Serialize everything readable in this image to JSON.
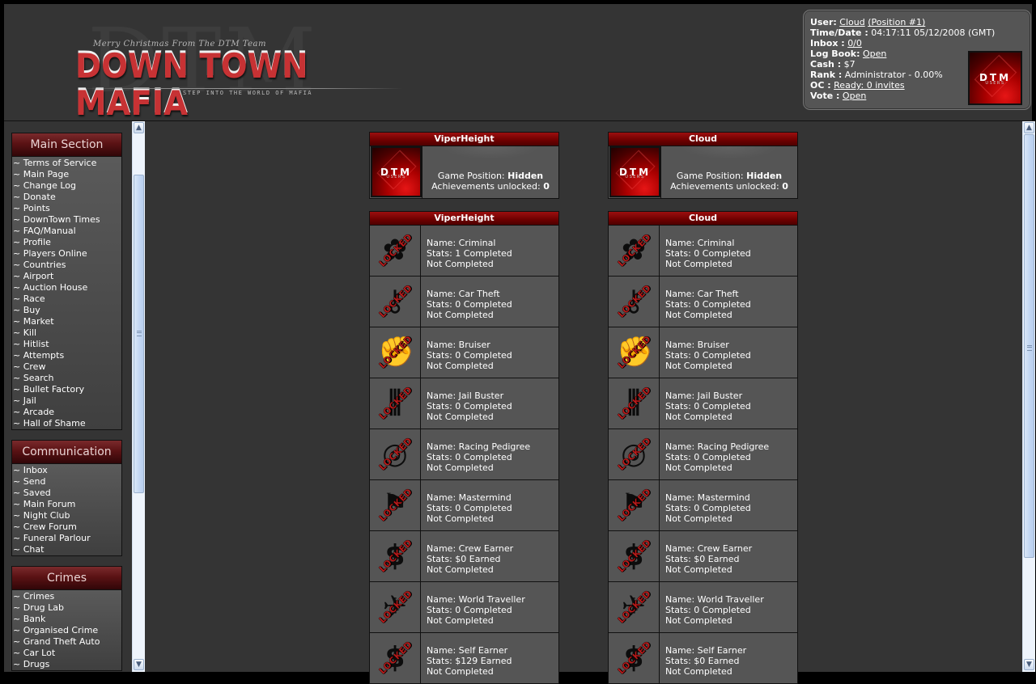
{
  "header": {
    "logo": {
      "watermark": "DTM",
      "greeting": "Merry Christmas From The DTM Team",
      "title": "DOWN TOWN MAFIA",
      "tagline": "STEP INTO THE WORLD OF MAFIA"
    },
    "userbox": {
      "user_label": "User:",
      "user_name": "Cloud",
      "user_position": "(Position #1)",
      "time_label": "Time/Date :",
      "time_value": "04:17:11 05/12/2008 (GMT)",
      "inbox_label": "Inbox :",
      "inbox_value": "0/0",
      "logbook_label": "Log Book:",
      "logbook_value": "Open",
      "cash_label": "Cash :",
      "cash_value": "$7",
      "rank_label": "Rank :",
      "rank_value": "Administrator - 0.00%",
      "oc_label": "OC :",
      "oc_value": "Ready: 0 invites",
      "vote_label": "Vote :",
      "vote_value": "Open",
      "avatar": {
        "title": "DTM",
        "subtitle": "USERS"
      }
    }
  },
  "sidebar": {
    "panels": [
      {
        "title": "Main Section",
        "items": [
          "Terms of Service",
          "Main Page",
          "Change Log",
          "Donate",
          "Points",
          "DownTown Times",
          "FAQ/Manual",
          "Profile",
          "Players Online",
          "Countries",
          "Airport",
          "Auction House",
          "Race",
          "Buy",
          "Market",
          "Kill",
          "Hitlist",
          "Attempts",
          "Crew",
          "Search",
          "Bullet Factory",
          "Jail",
          "Arcade",
          "Hall of Shame"
        ]
      },
      {
        "title": "Communication",
        "items": [
          "Inbox",
          "Send",
          "Saved",
          "Main Forum",
          "Night Club",
          "Crew Forum",
          "Funeral Parlour",
          "Chat"
        ]
      },
      {
        "title": "Crimes",
        "items": [
          "Crimes",
          "Drug Lab",
          "Bank",
          "Organised Crime",
          "Grand Theft Auto",
          "Car Lot",
          "Drugs"
        ]
      }
    ]
  },
  "main": {
    "locked_stamp": "LOCKED",
    "position_label": "Game Position:",
    "achievements_label": "Achievements unlocked:",
    "columns": [
      {
        "player": "ViperHeight",
        "game_position": "Hidden",
        "achievements_unlocked": "0",
        "avatar": {
          "title": "DTM",
          "subtitle": "USERS"
        },
        "achievements": [
          {
            "icon": "criminal-icon",
            "name": "Name: Criminal",
            "stats": "Stats: 1 Completed",
            "status": "Not Completed"
          },
          {
            "icon": "car-keys-icon",
            "name": "Name: Car Theft",
            "stats": "Stats: 0 Completed",
            "status": "Not Completed"
          },
          {
            "icon": "fist-icon",
            "name": "Name: Bruiser",
            "stats": "Stats: 0 Completed",
            "status": "Not Completed"
          },
          {
            "icon": "jail-icon",
            "name": "Name: Jail Buster",
            "stats": "Stats: 0 Completed",
            "status": "Not Completed"
          },
          {
            "icon": "steering-wheel-icon",
            "name": "Name: Racing Pedigree",
            "stats": "Stats: 0 Completed",
            "status": "Not Completed"
          },
          {
            "icon": "gunman-icon",
            "name": "Name: Mastermind",
            "stats": "Stats: 0 Completed",
            "status": "Not Completed"
          },
          {
            "icon": "crew-dollar-icon",
            "name": "Name: Crew Earner",
            "stats": "Stats: $0 Earned",
            "status": "Not Completed"
          },
          {
            "icon": "airplane-icon",
            "name": "Name: World Traveller",
            "stats": "Stats: 0 Completed",
            "status": "Not Completed"
          },
          {
            "icon": "dollar-icon",
            "name": "Name: Self Earner",
            "stats": "Stats: $129 Earned",
            "status": "Not Completed"
          }
        ]
      },
      {
        "player": "Cloud",
        "game_position": "Hidden",
        "achievements_unlocked": "0",
        "avatar": {
          "title": "DTM",
          "subtitle": "USERS"
        },
        "achievements": [
          {
            "icon": "criminal-icon",
            "name": "Name: Criminal",
            "stats": "Stats: 0 Completed",
            "status": "Not Completed"
          },
          {
            "icon": "car-keys-icon",
            "name": "Name: Car Theft",
            "stats": "Stats: 0 Completed",
            "status": "Not Completed"
          },
          {
            "icon": "fist-icon",
            "name": "Name: Bruiser",
            "stats": "Stats: 0 Completed",
            "status": "Not Completed"
          },
          {
            "icon": "jail-icon",
            "name": "Name: Jail Buster",
            "stats": "Stats: 0 Completed",
            "status": "Not Completed"
          },
          {
            "icon": "steering-wheel-icon",
            "name": "Name: Racing Pedigree",
            "stats": "Stats: 0 Completed",
            "status": "Not Completed"
          },
          {
            "icon": "gunman-icon",
            "name": "Name: Mastermind",
            "stats": "Stats: 0 Completed",
            "status": "Not Completed"
          },
          {
            "icon": "crew-dollar-icon",
            "name": "Name: Crew Earner",
            "stats": "Stats: $0 Earned",
            "status": "Not Completed"
          },
          {
            "icon": "airplane-icon",
            "name": "Name: World Traveller",
            "stats": "Stats: 0 Completed",
            "status": "Not Completed"
          },
          {
            "icon": "dollar-icon",
            "name": "Name: Self Earner",
            "stats": "Stats: $0 Earned",
            "status": "Not Completed"
          }
        ]
      }
    ]
  },
  "colors": {
    "background": "#343434",
    "panel_header_red": "#5a1214",
    "card_header_red": "#6e0000",
    "locked_red": "#c01c1c",
    "cell_bg": "#555555"
  }
}
